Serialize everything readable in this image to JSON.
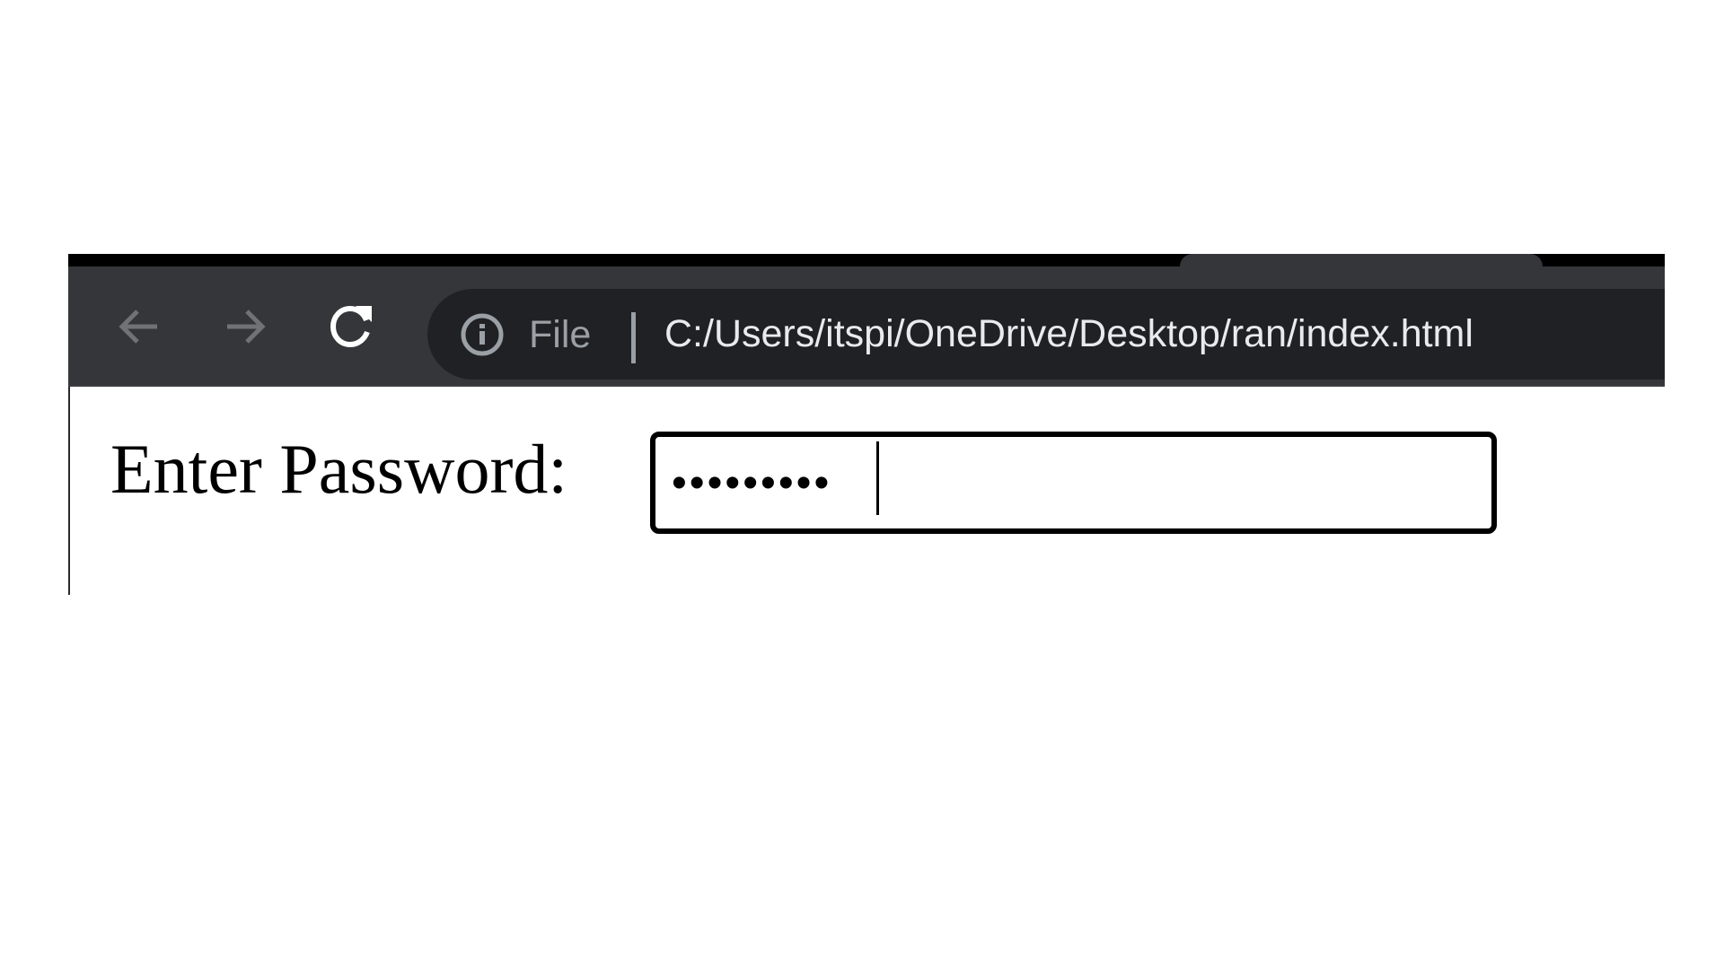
{
  "browser": {
    "toolbar": {
      "back_icon": "arrow-left-icon",
      "forward_icon": "arrow-right-icon",
      "reload_icon": "reload-icon"
    },
    "address_bar": {
      "info_icon": "info-icon",
      "scheme_label": "File",
      "url": "C:/Users/itspi/OneDrive/Desktop/ran/index.html"
    }
  },
  "page": {
    "password_label": "Enter Password:",
    "password_value": "•••••••••",
    "password_length": 9
  },
  "colors": {
    "browser_frame": "#35363a",
    "omnibox_background": "#202124",
    "inactive_icon": "#9aa0a6",
    "url_text": "#e8eaed",
    "page_background": "#ffffff",
    "input_border": "#000000"
  }
}
